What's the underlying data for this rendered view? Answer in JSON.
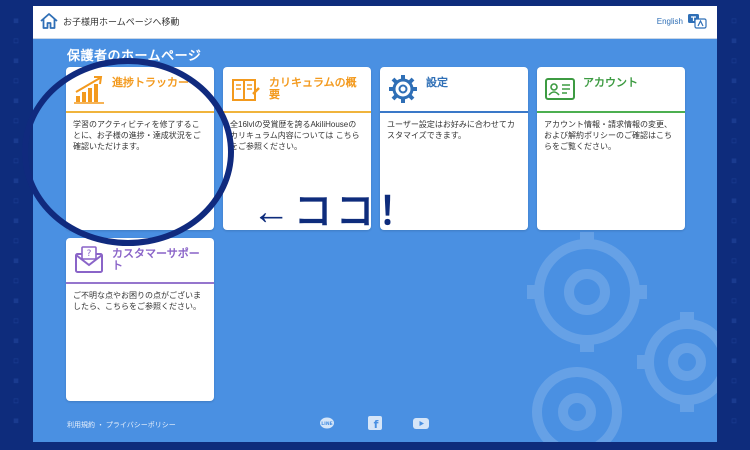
{
  "header": {
    "back_link": "お子様用ホームページへ移動",
    "language": "English"
  },
  "page_title": "保護者のホームページ",
  "cards": [
    {
      "title": "進捗トラッカー",
      "desc": "学習のアクティビティを修了することに、お子様の進捗・達成状況をご確認いただけます。"
    },
    {
      "title": "カリキュラムの概要",
      "desc": "全16lvlの受賞歴を誇るAkiliHouseのカリキュラム内容については こちらをご参照ください。"
    },
    {
      "title": "設定",
      "desc": "ユーザー設定はお好みに合わせてカスタマイズできます。"
    },
    {
      "title": "アカウント",
      "desc": "アカウント情報・請求情報の変更、および解約ポリシーのご確認はこちらをご覧ください。"
    },
    {
      "title": "カスタマーサポート",
      "desc": "ご不明な点やお困りの点がございましたら、こちらをご参照ください。"
    }
  ],
  "footer": {
    "links": "利用規約 ・ プライバシーポリシー"
  },
  "annotation": {
    "text": "←ココ！"
  },
  "colors": {
    "background": "#0e2c7c",
    "panel": "#4a90e2",
    "accent_orange": "#f39a1e",
    "accent_blue": "#2f6fb6",
    "accent_green": "#3d9b42",
    "accent_purple": "#8a64c8"
  },
  "icons": {
    "home": "home-icon",
    "language": "globe-language-icon",
    "progress": "bar-chart-icon",
    "curriculum": "book-icon",
    "settings": "gear-icon",
    "account": "id-card-icon",
    "support": "envelope-icon",
    "line": "line-icon",
    "facebook": "facebook-icon",
    "youtube": "youtube-icon"
  }
}
